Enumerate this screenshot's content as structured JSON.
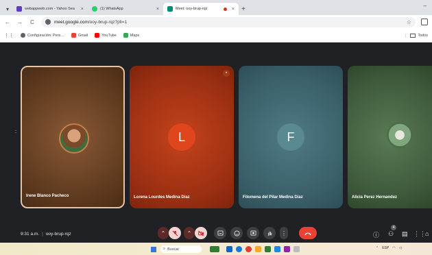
{
  "browser": {
    "tabs": [
      {
        "title": "webappweb.com - Yahoo Sea",
        "favicon_color": "#5f3dc4",
        "active": false
      },
      {
        "title": "(1) WhatsApp",
        "favicon_color": "#25d366",
        "active": false
      },
      {
        "title": "Meet: ooy-brup-rqz",
        "favicon_color": "#00897b",
        "active": true
      }
    ],
    "new_tab": "+",
    "close_glyph": "×",
    "minimize": "–",
    "back": "←",
    "forward": "→",
    "reload": "C",
    "url_domain": "meet.google.com",
    "url_path": "/ooy-brup-rqz?pli=1",
    "star": "☆",
    "bookmarks": [
      {
        "label": "Configuración: Pers…",
        "color": "#5f6368"
      },
      {
        "label": "Gmail",
        "color": "#ea4335"
      },
      {
        "label": "YouTube",
        "color": "#ff0000"
      },
      {
        "label": "Maps",
        "color": "#34a853"
      }
    ],
    "bookmarks_folder": "Todos"
  },
  "meet": {
    "participants": [
      {
        "name": "Irene Blanco Pacheco",
        "avatar": "photo"
      },
      {
        "name": "Lorena Lourdes Medina Diaz",
        "avatar": "L"
      },
      {
        "name": "Filomena del Pilar Medina Diaz",
        "avatar": "F"
      },
      {
        "name": "Alicia Perez Hernandez",
        "avatar": "photo"
      }
    ],
    "time": "9:31 a.m.",
    "meeting_code": "ooy-brup-rqz",
    "separator": "|",
    "participant_count": "4",
    "colors": {
      "stage_bg": "#202124",
      "end_call": "#ea4335"
    }
  },
  "taskbar": {
    "search_placeholder": "Buscar",
    "lang": "ESP"
  }
}
